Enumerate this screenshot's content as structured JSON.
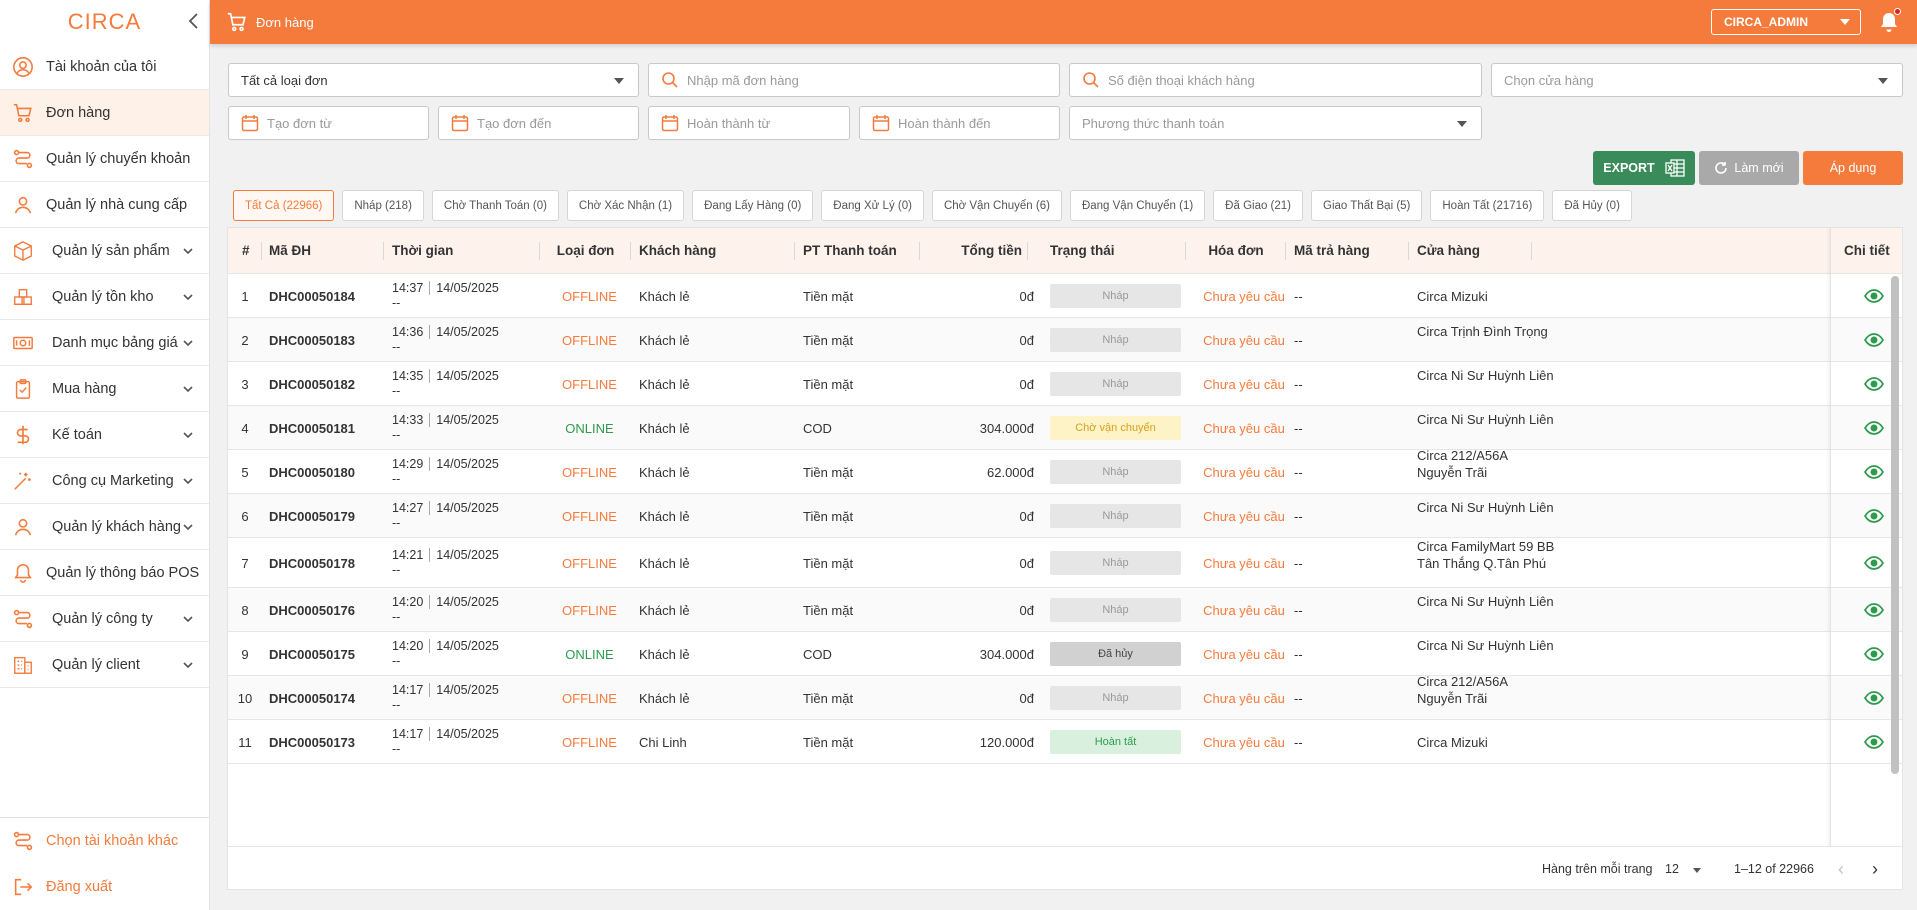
{
  "app": {
    "logo_text": "CIRCA"
  },
  "sidebar": {
    "items": [
      {
        "label": "Tài khoản của tôi",
        "icon": "user-circle-icon"
      },
      {
        "label": "Đơn hàng",
        "icon": "cart-icon",
        "active": true
      },
      {
        "label": "Quản lý chuyển khoản",
        "icon": "transfer-icon"
      },
      {
        "label": "Quản lý nhà cung cấp",
        "icon": "person-icon"
      },
      {
        "label": "Quản lý sản phẩm",
        "icon": "box-icon",
        "has_children": true
      },
      {
        "label": "Quản lý tồn kho",
        "icon": "warehouse-icon",
        "has_children": true
      },
      {
        "label": "Danh mục bảng giá",
        "icon": "money-icon",
        "has_children": true
      },
      {
        "label": "Mua hàng",
        "icon": "clipboard-icon",
        "has_children": true
      },
      {
        "label": "Kế toán",
        "icon": "dollar-icon",
        "has_children": true
      },
      {
        "label": "Công cụ Marketing",
        "icon": "magic-wand-icon",
        "has_children": true
      },
      {
        "label": "Quản lý khách hàng",
        "icon": "person-icon",
        "has_children": true
      },
      {
        "label": "Quản lý thông báo POS",
        "icon": "bell-icon"
      },
      {
        "label": "Quản lý công ty",
        "icon": "transfer-icon",
        "has_children": true
      },
      {
        "label": "Quản lý client",
        "icon": "building-icon",
        "has_children": true
      }
    ],
    "bottom": [
      {
        "label": "Chọn tài khoản khác",
        "icon": "switch-account-icon"
      },
      {
        "label": "Đăng xuất",
        "icon": "logout-icon"
      }
    ]
  },
  "header": {
    "title": "Đơn hàng",
    "user": "CIRCA_ADMIN"
  },
  "filters": {
    "order_type": "Tất cả loại đơn",
    "order_code_placeholder": "Nhập mã đơn hàng",
    "phone_placeholder": "Số điện thoại khách hàng",
    "store_placeholder": "Chọn cửa hàng",
    "created_from": "Tạo đơn từ",
    "created_to": "Tạo đơn đến",
    "completed_from": "Hoàn thành từ",
    "completed_to": "Hoàn thành đến",
    "payment_placeholder": "Phương thức thanh toán"
  },
  "actions": {
    "export": "EXPORT",
    "refresh": "Làm mới",
    "apply": "Áp dụng"
  },
  "tabs": [
    "Tất Cả (22966)",
    "Nháp (218)",
    "Chờ Thanh Toán (0)",
    "Chờ Xác Nhận (1)",
    "Đang Lấy Hàng (0)",
    "Đang Xử Lý (0)",
    "Chờ Vận Chuyển (6)",
    "Đang Vận Chuyển (1)",
    "Đã Giao (21)",
    "Giao Thất Bại (5)",
    "Hoàn Tất (21716)",
    "Đã Hủy (0)"
  ],
  "table": {
    "columns": [
      "#",
      "Mã ĐH",
      "Thời gian",
      "Loại đơn",
      "Khách hàng",
      "PT Thanh toán",
      "Tổng tiền",
      "Trạng thái",
      "Hóa đơn",
      "Mã trả hàng",
      "Cửa hàng",
      "Chi tiết"
    ],
    "rows": [
      {
        "no": "1",
        "code": "DHC00050184",
        "time": "14:37",
        "date": "14/05/2025",
        "done": "--",
        "type": "OFFLINE",
        "customer": "Khách lẻ",
        "payment": "Tiền mặt",
        "total": "0đ",
        "status": "Nháp",
        "invoice": "Chưa yêu cầu",
        "return_code": "--",
        "store": "Circa Mizuki"
      },
      {
        "no": "2",
        "code": "DHC00050183",
        "time": "14:36",
        "date": "14/05/2025",
        "done": "--",
        "type": "OFFLINE",
        "customer": "Khách lẻ",
        "payment": "Tiền mặt",
        "total": "0đ",
        "status": "Nháp",
        "invoice": "Chưa yêu cầu",
        "return_code": "--",
        "store": "Circa Trịnh Đình Trọng"
      },
      {
        "no": "3",
        "code": "DHC00050182",
        "time": "14:35",
        "date": "14/05/2025",
        "done": "--",
        "type": "OFFLINE",
        "customer": "Khách lẻ",
        "payment": "Tiền mặt",
        "total": "0đ",
        "status": "Nháp",
        "invoice": "Chưa yêu cầu",
        "return_code": "--",
        "store": "Circa Ni Sư Huỳnh Liên"
      },
      {
        "no": "4",
        "code": "DHC00050181",
        "time": "14:33",
        "date": "14/05/2025",
        "done": "--",
        "type": "ONLINE",
        "customer": "Khách lẻ",
        "payment": "COD",
        "total": "304.000đ",
        "status": "Chờ vận chuyển",
        "invoice": "Chưa yêu cầu",
        "return_code": "--",
        "store": "Circa Ni Sư Huỳnh Liên"
      },
      {
        "no": "5",
        "code": "DHC00050180",
        "time": "14:29",
        "date": "14/05/2025",
        "done": "--",
        "type": "OFFLINE",
        "customer": "Khách lẻ",
        "payment": "Tiền mặt",
        "total": "62.000đ",
        "status": "Nháp",
        "invoice": "Chưa yêu cầu",
        "return_code": "--",
        "store": "Circa 212/A56A Nguyễn Trãi"
      },
      {
        "no": "6",
        "code": "DHC00050179",
        "time": "14:27",
        "date": "14/05/2025",
        "done": "--",
        "type": "OFFLINE",
        "customer": "Khách lẻ",
        "payment": "Tiền mặt",
        "total": "0đ",
        "status": "Nháp",
        "invoice": "Chưa yêu cầu",
        "return_code": "--",
        "store": "Circa Ni Sư Huỳnh Liên"
      },
      {
        "no": "7",
        "code": "DHC00050178",
        "time": "14:21",
        "date": "14/05/2025",
        "done": "--",
        "type": "OFFLINE",
        "customer": "Khách lẻ",
        "payment": "Tiền mặt",
        "total": "0đ",
        "status": "Nháp",
        "invoice": "Chưa yêu cầu",
        "return_code": "--",
        "store": "Circa FamilyMart 59 BB Tân Thắng Q.Tân Phú"
      },
      {
        "no": "8",
        "code": "DHC00050176",
        "time": "14:20",
        "date": "14/05/2025",
        "done": "--",
        "type": "OFFLINE",
        "customer": "Khách lẻ",
        "payment": "Tiền mặt",
        "total": "0đ",
        "status": "Nháp",
        "invoice": "Chưa yêu cầu",
        "return_code": "--",
        "store": "Circa Ni Sư Huỳnh Liên"
      },
      {
        "no": "9",
        "code": "DHC00050175",
        "time": "14:20",
        "date": "14/05/2025",
        "done": "--",
        "type": "ONLINE",
        "customer": "Khách lẻ",
        "payment": "COD",
        "total": "304.000đ",
        "status": "Đã hủy",
        "invoice": "Chưa yêu cầu",
        "return_code": "--",
        "store": "Circa Ni Sư Huỳnh Liên"
      },
      {
        "no": "10",
        "code": "DHC00050174",
        "time": "14:17",
        "date": "14/05/2025",
        "done": "--",
        "type": "OFFLINE",
        "customer": "Khách lẻ",
        "payment": "Tiền mặt",
        "total": "0đ",
        "status": "Nháp",
        "invoice": "Chưa yêu cầu",
        "return_code": "--",
        "store": "Circa 212/A56A Nguyễn Trãi"
      },
      {
        "no": "11",
        "code": "DHC00050173",
        "time": "14:17",
        "date": "14/05/2025",
        "done": "--",
        "type": "OFFLINE",
        "customer": "Chi Linh",
        "payment": "Tiền mặt",
        "total": "120.000đ",
        "status": "Hoàn tất",
        "invoice": "Chưa yêu cầu",
        "return_code": "--",
        "store": "Circa Mizuki"
      }
    ]
  },
  "pagination": {
    "rows_per_page_label": "Hàng trên mỗi trang",
    "rows_per_page": "12",
    "range": "1–12 of 22966"
  },
  "colors": {
    "accent": "#f47b3c",
    "online": "#2e9a4d",
    "export": "#3a8b5a"
  }
}
